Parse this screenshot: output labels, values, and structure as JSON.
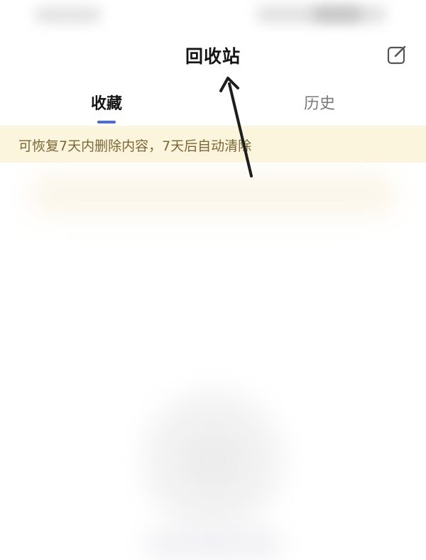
{
  "header": {
    "title": "回收站",
    "edit_icon": "edit-icon"
  },
  "tabs": [
    {
      "label": "收藏",
      "active": true
    },
    {
      "label": "历史",
      "active": false
    }
  ],
  "notice": {
    "text": "可恢复7天内删除内容，7天后自动清除"
  },
  "colors": {
    "accent": "#4e6cc8",
    "notice_background": "#fcf5dd",
    "notice_text": "#7a6535"
  }
}
